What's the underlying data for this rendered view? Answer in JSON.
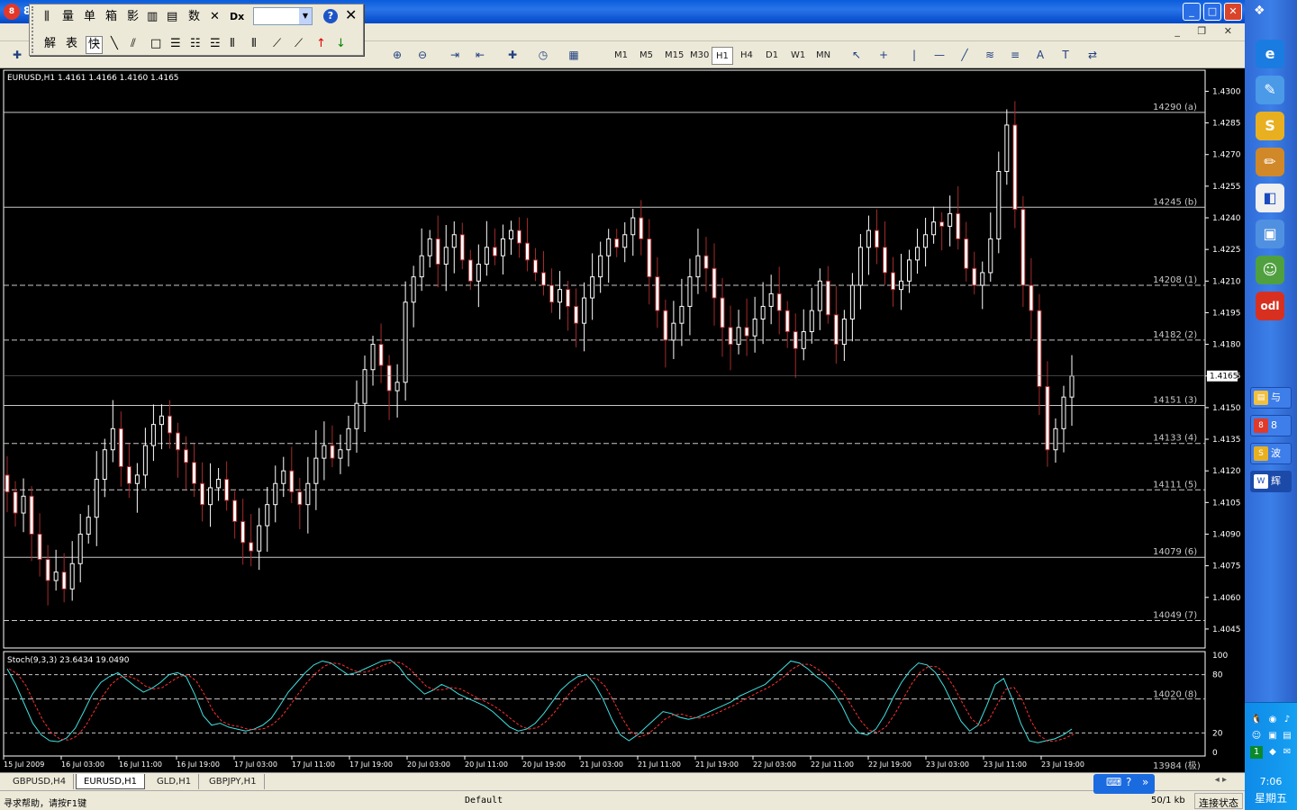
{
  "window": {
    "title": "8"
  },
  "menubar": {
    "mdi_icons": "_ ❐ ✕"
  },
  "float_toolbar": {
    "row1": [
      "量",
      "单",
      "箱",
      "影",
      "数"
    ],
    "row2": [
      "解",
      "表",
      "快"
    ],
    "help": "?",
    "close": "✕"
  },
  "toolbar": {
    "timeframes": [
      "M1",
      "M5",
      "M15",
      "M30",
      "H1",
      "H4",
      "D1",
      "W1",
      "MN"
    ],
    "active_timeframe": "H1",
    "icons": [
      "new-chart-icon",
      "zoom-in-icon",
      "zoom-out-icon",
      "chart-shift-icon",
      "autoscroll-icon",
      "indicators-icon",
      "periods-icon",
      "templates-icon",
      "cursor-icon",
      "crosshair-icon",
      "vertical-line-icon",
      "horizontal-line-icon",
      "trendline-icon",
      "fibonacci-icon",
      "text-icon",
      "text-label-icon",
      "arrows-icon"
    ]
  },
  "chart_data": {
    "type": "candlestick",
    "symbol_line": "EURUSD,H1  1.4161 1.4166 1.4160 1.4165",
    "ylim": [
      1.4036,
      1.431
    ],
    "yticks": [
      "1.4300",
      "1.4285",
      "1.4270",
      "1.4255",
      "1.4240",
      "1.4225",
      "1.4210",
      "1.4195",
      "1.4180",
      "1.4165",
      "1.4150",
      "1.4135",
      "1.4120",
      "1.4105",
      "1.4090",
      "1.4075",
      "1.4060",
      "1.4045"
    ],
    "current_price": "1.4165",
    "bull_color": "#ffffff",
    "bull_body_color": "#000000",
    "bear_color": "#a52a2a",
    "levels": [
      {
        "value": 1.429,
        "label": "14290 (a)",
        "style": "solid"
      },
      {
        "value": 1.4245,
        "label": "14245 (b)",
        "style": "solid"
      },
      {
        "value": 1.4208,
        "label": "14208 (1)",
        "style": "dashed"
      },
      {
        "value": 1.4182,
        "label": "14182 (2)",
        "style": "dashed"
      },
      {
        "value": 1.4151,
        "label": "14151 (3)",
        "style": "solid"
      },
      {
        "value": 1.4133,
        "label": "14133 (4)",
        "style": "dashed"
      },
      {
        "value": 1.4111,
        "label": "14111 (5)",
        "style": "dashed"
      },
      {
        "value": 1.4079,
        "label": "14079 (6)",
        "style": "solid"
      },
      {
        "value": 1.4049,
        "label": "14049 (7)",
        "style": "dashed"
      }
    ],
    "indicator": {
      "title": "Stoch(9,3,3) 23.6434 19.0490",
      "ylim": [
        0,
        100
      ],
      "yticks": [
        "100",
        "80",
        "20",
        "0"
      ],
      "levels": [
        80,
        20
      ],
      "extra_labels": [
        "14020 (8)",
        "13984 (极)"
      ],
      "main_color": "#40e0e0",
      "signal_color": "#ff3030"
    },
    "xlabels": [
      "15 Jul 2009",
      "16 Jul 03:00",
      "16 Jul 11:00",
      "16 Jul 19:00",
      "17 Jul 03:00",
      "17 Jul 11:00",
      "17 Jul 19:00",
      "20 Jul 03:00",
      "20 Jul 11:00",
      "20 Jul 19:00",
      "21 Jul 03:00",
      "21 Jul 11:00",
      "21 Jul 19:00",
      "22 Jul 03:00",
      "22 Jul 11:00",
      "22 Jul 19:00",
      "23 Jul 03:00",
      "23 Jul 11:00",
      "23 Jul 19:00"
    ],
    "closes": [
      1.411,
      1.41,
      1.4108,
      1.409,
      1.4078,
      1.4068,
      1.4072,
      1.4064,
      1.4076,
      1.409,
      1.4098,
      1.4116,
      1.413,
      1.414,
      1.4122,
      1.4114,
      1.4118,
      1.4132,
      1.4142,
      1.4146,
      1.4138,
      1.413,
      1.4124,
      1.4114,
      1.4104,
      1.4112,
      1.4116,
      1.4106,
      1.4096,
      1.4086,
      1.4082,
      1.4094,
      1.4104,
      1.4114,
      1.412,
      1.411,
      1.4104,
      1.4114,
      1.4126,
      1.4132,
      1.4126,
      1.413,
      1.414,
      1.4152,
      1.4168,
      1.418,
      1.417,
      1.4158,
      1.4162,
      1.42,
      1.4212,
      1.4222,
      1.423,
      1.4218,
      1.4226,
      1.4232,
      1.422,
      1.421,
      1.4218,
      1.4226,
      1.4222,
      1.423,
      1.4234,
      1.4228,
      1.422,
      1.4214,
      1.4208,
      1.42,
      1.4206,
      1.4198,
      1.419,
      1.4202,
      1.4212,
      1.4222,
      1.423,
      1.4226,
      1.4232,
      1.424,
      1.423,
      1.4212,
      1.4196,
      1.4182,
      1.419,
      1.4198,
      1.4212,
      1.4222,
      1.4216,
      1.4202,
      1.4188,
      1.418,
      1.4188,
      1.4184,
      1.4192,
      1.4198,
      1.4204,
      1.4196,
      1.4186,
      1.4178,
      1.4186,
      1.4196,
      1.421,
      1.4194,
      1.418,
      1.4192,
      1.4208,
      1.4226,
      1.4234,
      1.4226,
      1.4214,
      1.4206,
      1.421,
      1.422,
      1.4226,
      1.4232,
      1.4238,
      1.4236,
      1.4242,
      1.423,
      1.4216,
      1.4208,
      1.4214,
      1.423,
      1.4262,
      1.4284,
      1.4244,
      1.4208,
      1.4196,
      1.416,
      1.413,
      1.414,
      1.4155,
      1.4165
    ],
    "stoch_main": [
      86,
      70,
      50,
      30,
      18,
      12,
      11,
      15,
      25,
      42,
      60,
      72,
      78,
      82,
      75,
      68,
      62,
      66,
      72,
      80,
      82,
      78,
      60,
      38,
      28,
      30,
      26,
      24,
      22,
      24,
      28,
      35,
      48,
      62,
      72,
      82,
      90,
      94,
      92,
      86,
      80,
      82,
      86,
      90,
      94,
      95,
      88,
      76,
      68,
      60,
      64,
      70,
      66,
      60,
      56,
      52,
      48,
      42,
      34,
      26,
      22,
      24,
      30,
      40,
      52,
      64,
      72,
      78,
      80,
      70,
      54,
      34,
      18,
      12,
      18,
      26,
      34,
      42,
      40,
      36,
      34,
      36,
      40,
      44,
      48,
      52,
      58,
      62,
      66,
      70,
      78,
      86,
      94,
      92,
      86,
      78,
      72,
      62,
      48,
      30,
      20,
      18,
      24,
      38,
      56,
      72,
      84,
      92,
      90,
      82,
      68,
      50,
      32,
      22,
      28,
      48,
      70,
      76,
      55,
      30,
      12,
      10,
      12,
      14,
      18,
      24
    ]
  },
  "tabs": [
    "GBPUSD,H4",
    "EURUSD,H1",
    "GLD,H1",
    "GBPJPY,H1"
  ],
  "active_tab": "EURUSD,H1",
  "statusbar": {
    "help": "寻求帮助，请按F1键",
    "profile": "Default",
    "traffic": "50/1 kb",
    "connection": "连接状态"
  },
  "sidebar": {
    "tasks": [
      "与",
      "8",
      "波",
      "辉"
    ],
    "time": "7:06",
    "weekday": "星期五"
  }
}
